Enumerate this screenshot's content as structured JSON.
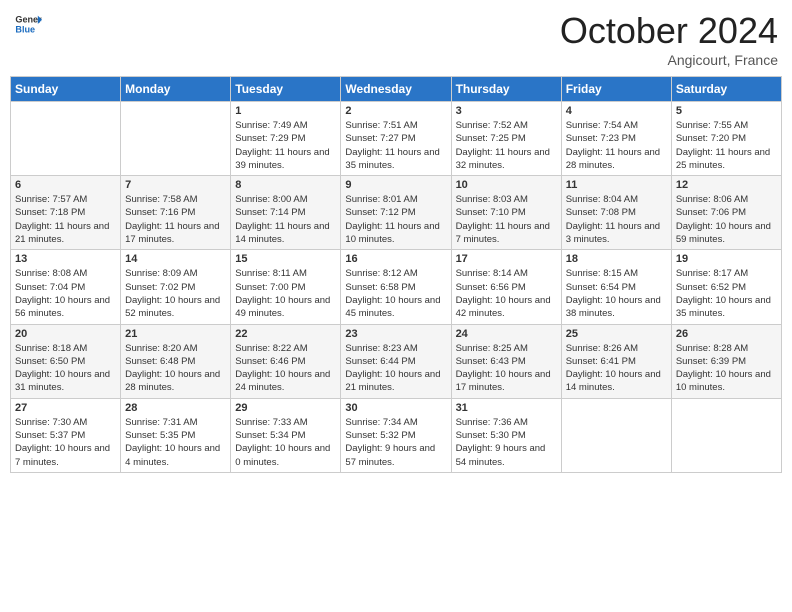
{
  "header": {
    "logo": {
      "general": "General",
      "blue": "Blue"
    },
    "title": "October 2024",
    "location": "Angicourt, France"
  },
  "days_of_week": [
    "Sunday",
    "Monday",
    "Tuesday",
    "Wednesday",
    "Thursday",
    "Friday",
    "Saturday"
  ],
  "weeks": [
    [
      {
        "day": "",
        "sunrise": "",
        "sunset": "",
        "daylight": ""
      },
      {
        "day": "",
        "sunrise": "",
        "sunset": "",
        "daylight": ""
      },
      {
        "day": "1",
        "sunrise": "Sunrise: 7:49 AM",
        "sunset": "Sunset: 7:29 PM",
        "daylight": "Daylight: 11 hours and 39 minutes."
      },
      {
        "day": "2",
        "sunrise": "Sunrise: 7:51 AM",
        "sunset": "Sunset: 7:27 PM",
        "daylight": "Daylight: 11 hours and 35 minutes."
      },
      {
        "day": "3",
        "sunrise": "Sunrise: 7:52 AM",
        "sunset": "Sunset: 7:25 PM",
        "daylight": "Daylight: 11 hours and 32 minutes."
      },
      {
        "day": "4",
        "sunrise": "Sunrise: 7:54 AM",
        "sunset": "Sunset: 7:23 PM",
        "daylight": "Daylight: 11 hours and 28 minutes."
      },
      {
        "day": "5",
        "sunrise": "Sunrise: 7:55 AM",
        "sunset": "Sunset: 7:20 PM",
        "daylight": "Daylight: 11 hours and 25 minutes."
      }
    ],
    [
      {
        "day": "6",
        "sunrise": "Sunrise: 7:57 AM",
        "sunset": "Sunset: 7:18 PM",
        "daylight": "Daylight: 11 hours and 21 minutes."
      },
      {
        "day": "7",
        "sunrise": "Sunrise: 7:58 AM",
        "sunset": "Sunset: 7:16 PM",
        "daylight": "Daylight: 11 hours and 17 minutes."
      },
      {
        "day": "8",
        "sunrise": "Sunrise: 8:00 AM",
        "sunset": "Sunset: 7:14 PM",
        "daylight": "Daylight: 11 hours and 14 minutes."
      },
      {
        "day": "9",
        "sunrise": "Sunrise: 8:01 AM",
        "sunset": "Sunset: 7:12 PM",
        "daylight": "Daylight: 11 hours and 10 minutes."
      },
      {
        "day": "10",
        "sunrise": "Sunrise: 8:03 AM",
        "sunset": "Sunset: 7:10 PM",
        "daylight": "Daylight: 11 hours and 7 minutes."
      },
      {
        "day": "11",
        "sunrise": "Sunrise: 8:04 AM",
        "sunset": "Sunset: 7:08 PM",
        "daylight": "Daylight: 11 hours and 3 minutes."
      },
      {
        "day": "12",
        "sunrise": "Sunrise: 8:06 AM",
        "sunset": "Sunset: 7:06 PM",
        "daylight": "Daylight: 10 hours and 59 minutes."
      }
    ],
    [
      {
        "day": "13",
        "sunrise": "Sunrise: 8:08 AM",
        "sunset": "Sunset: 7:04 PM",
        "daylight": "Daylight: 10 hours and 56 minutes."
      },
      {
        "day": "14",
        "sunrise": "Sunrise: 8:09 AM",
        "sunset": "Sunset: 7:02 PM",
        "daylight": "Daylight: 10 hours and 52 minutes."
      },
      {
        "day": "15",
        "sunrise": "Sunrise: 8:11 AM",
        "sunset": "Sunset: 7:00 PM",
        "daylight": "Daylight: 10 hours and 49 minutes."
      },
      {
        "day": "16",
        "sunrise": "Sunrise: 8:12 AM",
        "sunset": "Sunset: 6:58 PM",
        "daylight": "Daylight: 10 hours and 45 minutes."
      },
      {
        "day": "17",
        "sunrise": "Sunrise: 8:14 AM",
        "sunset": "Sunset: 6:56 PM",
        "daylight": "Daylight: 10 hours and 42 minutes."
      },
      {
        "day": "18",
        "sunrise": "Sunrise: 8:15 AM",
        "sunset": "Sunset: 6:54 PM",
        "daylight": "Daylight: 10 hours and 38 minutes."
      },
      {
        "day": "19",
        "sunrise": "Sunrise: 8:17 AM",
        "sunset": "Sunset: 6:52 PM",
        "daylight": "Daylight: 10 hours and 35 minutes."
      }
    ],
    [
      {
        "day": "20",
        "sunrise": "Sunrise: 8:18 AM",
        "sunset": "Sunset: 6:50 PM",
        "daylight": "Daylight: 10 hours and 31 minutes."
      },
      {
        "day": "21",
        "sunrise": "Sunrise: 8:20 AM",
        "sunset": "Sunset: 6:48 PM",
        "daylight": "Daylight: 10 hours and 28 minutes."
      },
      {
        "day": "22",
        "sunrise": "Sunrise: 8:22 AM",
        "sunset": "Sunset: 6:46 PM",
        "daylight": "Daylight: 10 hours and 24 minutes."
      },
      {
        "day": "23",
        "sunrise": "Sunrise: 8:23 AM",
        "sunset": "Sunset: 6:44 PM",
        "daylight": "Daylight: 10 hours and 21 minutes."
      },
      {
        "day": "24",
        "sunrise": "Sunrise: 8:25 AM",
        "sunset": "Sunset: 6:43 PM",
        "daylight": "Daylight: 10 hours and 17 minutes."
      },
      {
        "day": "25",
        "sunrise": "Sunrise: 8:26 AM",
        "sunset": "Sunset: 6:41 PM",
        "daylight": "Daylight: 10 hours and 14 minutes."
      },
      {
        "day": "26",
        "sunrise": "Sunrise: 8:28 AM",
        "sunset": "Sunset: 6:39 PM",
        "daylight": "Daylight: 10 hours and 10 minutes."
      }
    ],
    [
      {
        "day": "27",
        "sunrise": "Sunrise: 7:30 AM",
        "sunset": "Sunset: 5:37 PM",
        "daylight": "Daylight: 10 hours and 7 minutes."
      },
      {
        "day": "28",
        "sunrise": "Sunrise: 7:31 AM",
        "sunset": "Sunset: 5:35 PM",
        "daylight": "Daylight: 10 hours and 4 minutes."
      },
      {
        "day": "29",
        "sunrise": "Sunrise: 7:33 AM",
        "sunset": "Sunset: 5:34 PM",
        "daylight": "Daylight: 10 hours and 0 minutes."
      },
      {
        "day": "30",
        "sunrise": "Sunrise: 7:34 AM",
        "sunset": "Sunset: 5:32 PM",
        "daylight": "Daylight: 9 hours and 57 minutes."
      },
      {
        "day": "31",
        "sunrise": "Sunrise: 7:36 AM",
        "sunset": "Sunset: 5:30 PM",
        "daylight": "Daylight: 9 hours and 54 minutes."
      },
      {
        "day": "",
        "sunrise": "",
        "sunset": "",
        "daylight": ""
      },
      {
        "day": "",
        "sunrise": "",
        "sunset": "",
        "daylight": ""
      }
    ]
  ]
}
